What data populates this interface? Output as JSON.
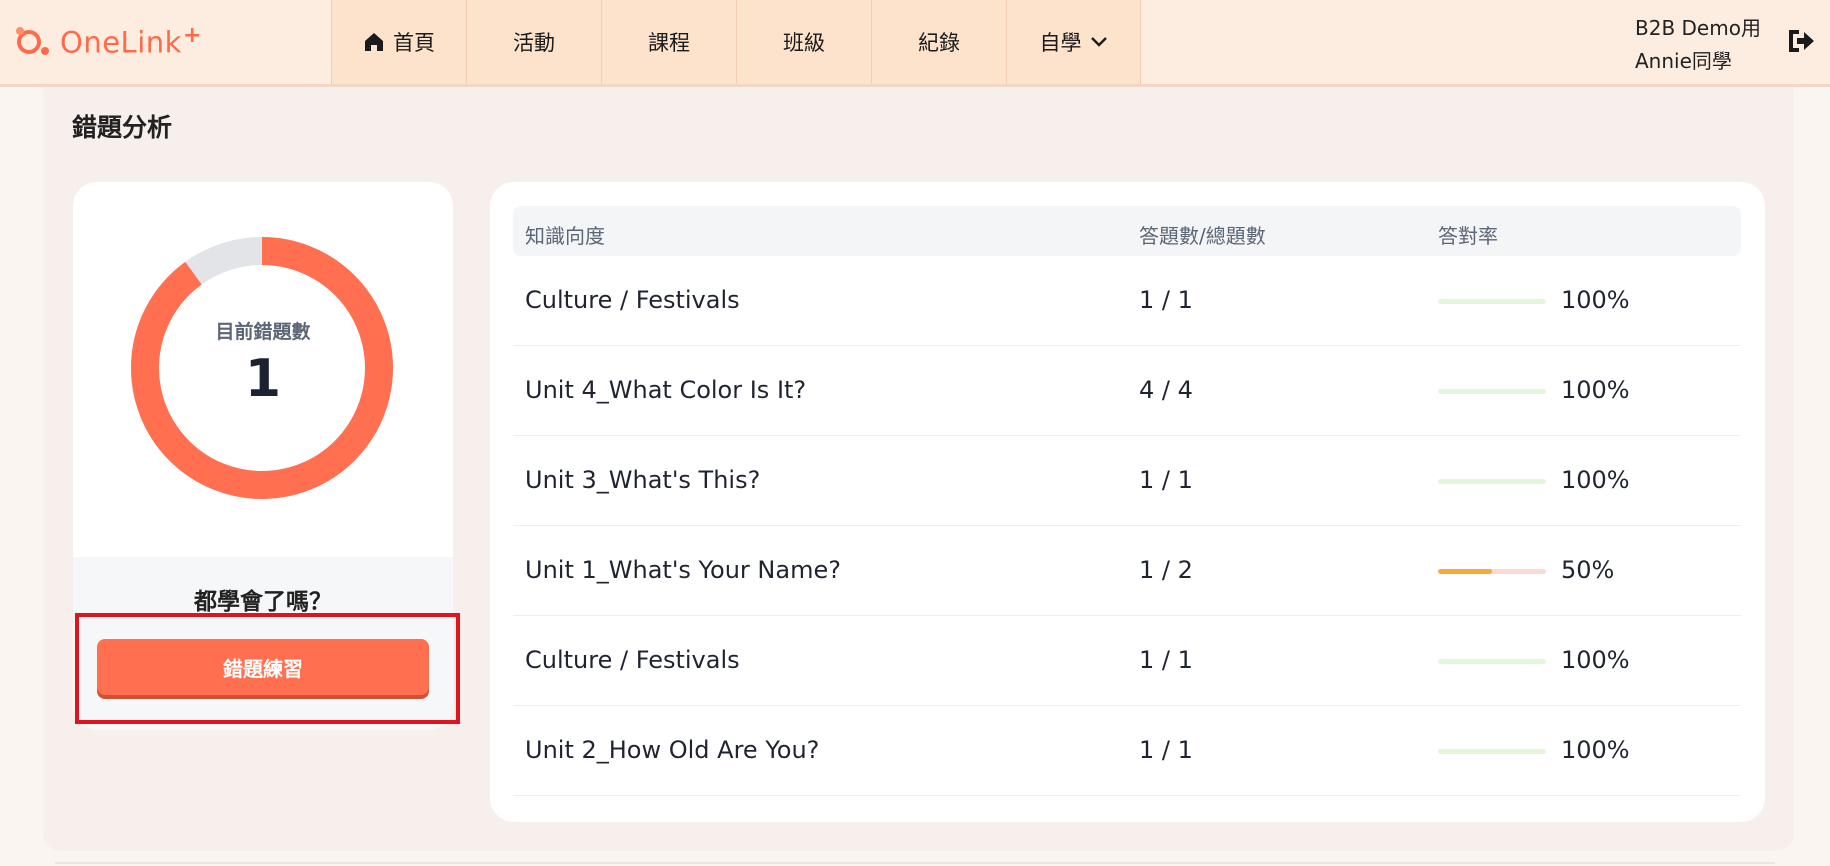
{
  "header": {
    "logo_text": "OneLink",
    "logo_plus": "+",
    "nav": [
      {
        "label": "首頁",
        "icon": "home-icon"
      },
      {
        "label": "活動"
      },
      {
        "label": "課程"
      },
      {
        "label": "班級"
      },
      {
        "label": "紀錄"
      },
      {
        "label": "自學",
        "icon": "chevron-down-icon"
      }
    ],
    "user_line1": "B2B Demo用",
    "user_line2": "Annie同學",
    "logout_icon": "logout-icon"
  },
  "page": {
    "title": "錯題分析"
  },
  "summary": {
    "donut_label": "目前錯題數",
    "wrong_count": "1",
    "wrong_fraction": 0.9,
    "prompt": "都學會了嗎？",
    "practice_button": "錯題練習",
    "colors": {
      "accent": "#ff6f50",
      "track": "#e2e4e8"
    }
  },
  "table": {
    "headers": {
      "topic": "知識向度",
      "count": "答題數/總題數",
      "rate": "答對率"
    },
    "rows": [
      {
        "topic": "Culture / Festivals",
        "count": "1 / 1",
        "rate": "100%",
        "rate_value": 100
      },
      {
        "topic": "Unit 4_What Color Is It?",
        "count": "4 / 4",
        "rate": "100%",
        "rate_value": 100
      },
      {
        "topic": "Unit 3_What's This?",
        "count": "1 / 1",
        "rate": "100%",
        "rate_value": 100
      },
      {
        "topic": "Unit 1_What's Your Name?",
        "count": "1 / 2",
        "rate": "50%",
        "rate_value": 50
      },
      {
        "topic": "Culture / Festivals",
        "count": "1 / 1",
        "rate": "100%",
        "rate_value": 100
      },
      {
        "topic": "Unit 2_How Old Are You?",
        "count": "1 / 1",
        "rate": "100%",
        "rate_value": 100
      }
    ],
    "colors": {
      "full_bar": "#e4f6da",
      "partial_bar": "#f7a93b",
      "partial_track": "#fcd9d5"
    }
  }
}
